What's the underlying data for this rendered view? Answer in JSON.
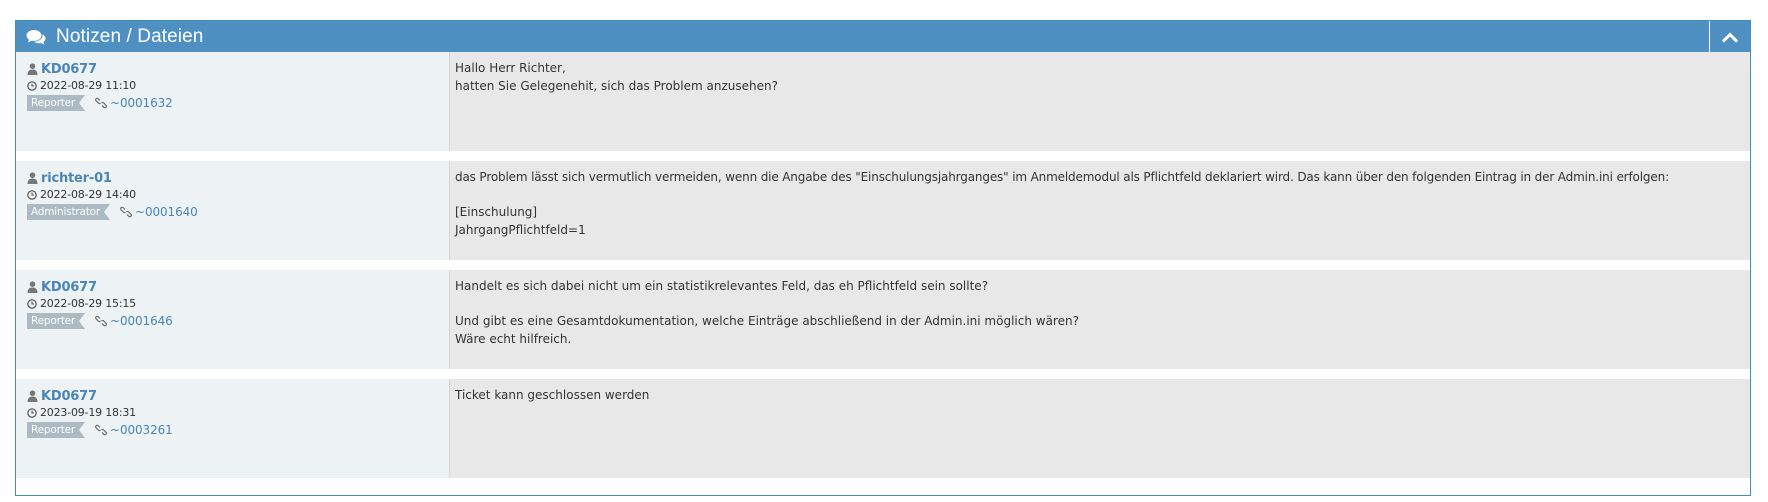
{
  "widget": {
    "title": "Notizen / Dateien",
    "header_icon": "comments-icon",
    "collapse_icon": "chevron-up-icon",
    "header_color": "#4f90c2"
  },
  "notes": [
    {
      "author": "KD0677",
      "date": "2022-08-29 11:10",
      "role": "Reporter",
      "ref": "~0001632",
      "lines": [
        "Hallo Herr Richter,",
        "hatten Sie Gelegenehit, sich das Problem anzusehen?"
      ]
    },
    {
      "author": "richter-01",
      "date": "2022-08-29 14:40",
      "role": "Administrator",
      "ref": "~0001640",
      "lines": [
        "das Problem lässt sich vermutlich vermeiden, wenn die Angabe des \"Einschulungsjahrganges\" im Anmeldemodul als Pflichtfeld deklariert wird. Das kann über den folgenden Eintrag in der Admin.ini erfolgen:",
        "",
        "[Einschulung]",
        "JahrgangPflichtfeld=1"
      ]
    },
    {
      "author": "KD0677",
      "date": "2022-08-29 15:15",
      "role": "Reporter",
      "ref": "~0001646",
      "lines": [
        "Handelt es sich dabei nicht um ein statistikrelevantes Feld, das eh Pflichtfeld sein sollte?",
        "",
        "Und gibt es eine Gesamtdokumentation, welche Einträge abschließend in der Admin.ini möglich wären?",
        "Wäre echt hilfreich."
      ]
    },
    {
      "author": "KD0677",
      "date": "2023-09-19 18:31",
      "role": "Reporter",
      "ref": "~0003261",
      "lines": [
        "Ticket kann geschlossen werden"
      ]
    }
  ]
}
